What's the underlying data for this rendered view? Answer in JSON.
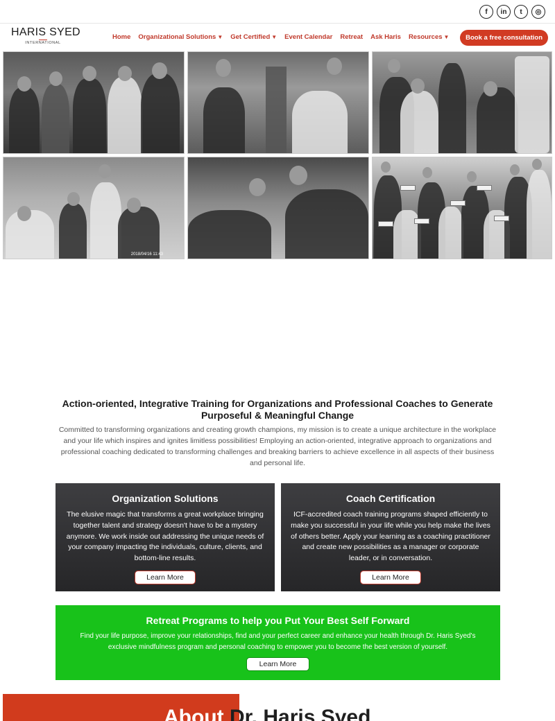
{
  "social": [
    {
      "name": "facebook",
      "glyph": "f"
    },
    {
      "name": "linkedin",
      "glyph": "in"
    },
    {
      "name": "twitter",
      "glyph": "t"
    },
    {
      "name": "instagram",
      "glyph": "◎"
    }
  ],
  "logo": {
    "main": "HARIS SYED",
    "sub": "INTERNATIONAL"
  },
  "nav": {
    "home": "Home",
    "org": "Organizational Solutions",
    "cert": "Get Certified",
    "events": "Event Calendar",
    "retreat": "Retreat",
    "ask": "Ask Haris",
    "resources": "Resources",
    "caret": "▼"
  },
  "cta": {
    "label": "Book a free consultation"
  },
  "photos": {
    "stamp": "2018/04/16 11:43"
  },
  "intro": {
    "title": "Action-oriented, Integrative Training for Organizations and Professional Coaches to Generate Purposeful & Meaningful Change",
    "text": "Committed to transforming organizations and creating growth champions, my mission is to create a unique architecture in the workplace and your life which inspires and ignites limitless possibilities! Employing an action-oriented, integrative approach to organizations and professional coaching dedicated to transforming challenges and breaking barriers to achieve excellence in all aspects of their business and personal life."
  },
  "cards": {
    "org": {
      "title": "Organization Solutions",
      "text": "The elusive magic that transforms a great workplace bringing together talent and strategy doesn't have to be a mystery anymore. We work inside out addressing the unique needs of your company impacting the individuals, culture, clients, and bottom-line results.",
      "button": "Learn More"
    },
    "coach": {
      "title": "Coach Certification",
      "text": "ICF-accredited coach training programs shaped efficiently to make you successful in your life while you help make the lives of others better. Apply your learning as a coaching practitioner and create new possibilities as a manager or corporate leader, or in conversation.",
      "button": "Learn More"
    }
  },
  "retreat": {
    "title": "Retreat Programs to help you Put Your Best Self Forward",
    "text": "Find your life purpose, improve your relationships, find and your perfect career and enhance your health through Dr. Haris Syed's exclusive mindfulness program and personal coaching to empower you to become the best version of yourself.",
    "button": "Learn More"
  },
  "about": {
    "word1": "About",
    "word2": "Dr. Haris Syed"
  },
  "colors": {
    "brand_red": "#d13b23",
    "nav_red": "#c0392b",
    "retreat_green": "#18c21a",
    "card_dark": "#333335"
  }
}
